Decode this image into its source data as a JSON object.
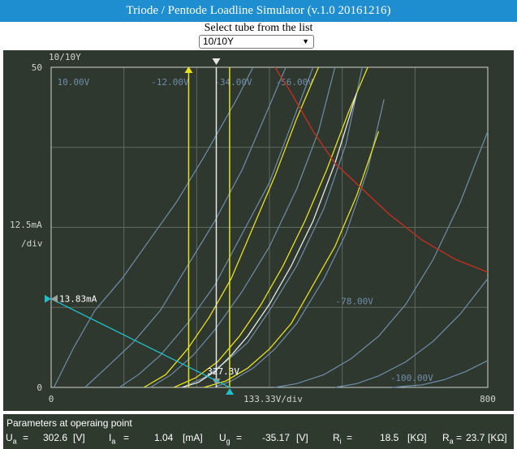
{
  "app": {
    "title": "Triode / Pentode Loadline Simulator (v.1.0 20161216)"
  },
  "selector": {
    "label": "Select tube from the list",
    "selected": "10/10Y"
  },
  "colors": {
    "background": "#2f382f",
    "grid": "#5d6a5d",
    "axis": "#cfd4cf",
    "curve": "#6f8da8",
    "highlight": "#e8e020",
    "operating": "#e8e8e8",
    "dissipation": "#b83020",
    "loadline": "#20c0c8"
  },
  "chart_data": {
    "type": "line",
    "title": "10/10Y",
    "xlim": [
      0,
      800
    ],
    "ylim": [
      0,
      50
    ],
    "x_tick_labels": [
      "0",
      "800"
    ],
    "y_tick_labels": [
      "0",
      "50"
    ],
    "x_div_label": "133.33V/div",
    "y_div_label": [
      "12.5mA",
      "/div"
    ],
    "grid": true,
    "series": [
      {
        "name": "10.00V",
        "anchor_x": 5,
        "x": [
          5,
          40,
          80,
          130,
          180,
          230,
          280,
          340,
          370
        ],
        "y": [
          0,
          6,
          12,
          17,
          23,
          29,
          36,
          45,
          50
        ]
      },
      {
        "name": "",
        "anchor_x": 62,
        "x": [
          62,
          100,
          150,
          200,
          250,
          300,
          350,
          400,
          430
        ],
        "y": [
          0,
          3,
          7,
          12,
          19,
          26,
          34,
          44,
          50
        ]
      },
      {
        "name": "",
        "anchor_x": 125,
        "x": [
          125,
          160,
          200,
          250,
          300,
          350,
          400,
          440,
          480
        ],
        "y": [
          0,
          2,
          5,
          10,
          16,
          24,
          32,
          41,
          50
        ]
      },
      {
        "name": "-12.00V",
        "anchor_x": 182,
        "x": [
          182,
          220,
          260,
          300,
          350,
          400,
          450,
          490,
          520
        ],
        "y": [
          0,
          2,
          5,
          9,
          15,
          22,
          31,
          40,
          50
        ]
      },
      {
        "name": "",
        "anchor_x": 240,
        "x": [
          240,
          280,
          320,
          360,
          400,
          450,
          500,
          540,
          570
        ],
        "y": [
          0,
          1.5,
          4,
          7,
          12,
          19,
          28,
          38,
          50
        ]
      },
      {
        "name": "-34.00V",
        "anchor_x": 298,
        "x": [
          298,
          330,
          370,
          410,
          450,
          500,
          540,
          580,
          610
        ],
        "y": [
          0,
          1,
          3,
          6,
          10,
          17,
          24,
          34,
          45
        ]
      },
      {
        "name": "-56.00V",
        "anchor_x": 410,
        "x": [
          410,
          450,
          500,
          550,
          600,
          650,
          700,
          750,
          800
        ],
        "y": [
          0,
          0.6,
          2,
          4.5,
          8,
          13,
          20,
          29,
          40
        ]
      },
      {
        "name": "-78.00V",
        "anchor_x": 520,
        "x": [
          520,
          560,
          600,
          650,
          700,
          750,
          800
        ],
        "y": [
          0,
          0.6,
          1.8,
          4,
          7.2,
          11.5,
          17
        ]
      },
      {
        "name": "-100.00V",
        "anchor_x": 625,
        "x": [
          625,
          680,
          720,
          760,
          800
        ],
        "y": [
          0,
          0.4,
          1.2,
          2.5,
          4.2
        ]
      }
    ],
    "highlight_series": [
      {
        "x": [
          170,
          210,
          250,
          290,
          330,
          370,
          410,
          450,
          490
        ],
        "y": [
          0,
          2,
          6,
          11,
          17,
          25,
          33,
          42,
          50
        ]
      },
      {
        "x": [
          225,
          265,
          305,
          345,
          385,
          425,
          465,
          505,
          545,
          580
        ],
        "y": [
          0,
          1.5,
          4,
          8,
          13,
          19,
          26,
          34,
          43,
          50
        ]
      },
      {
        "x": [
          280,
          320,
          360,
          400,
          440,
          480,
          520,
          560,
          600
        ],
        "y": [
          0,
          1,
          3,
          6,
          10,
          16,
          22,
          30,
          40
        ]
      }
    ],
    "operating_curve": {
      "x": [
        240,
        270,
        300,
        330,
        360,
        400,
        440,
        480,
        520,
        560
      ],
      "y": [
        0,
        0.8,
        2.5,
        5,
        8,
        13,
        19,
        26,
        35,
        46
      ]
    },
    "dissipation_curve": {
      "x": [
        410,
        440,
        480,
        520,
        570,
        620,
        680,
        740,
        800
      ],
      "y": [
        50,
        46,
        40,
        35,
        31,
        27,
        23,
        20,
        18
      ]
    },
    "load_line": {
      "x": [
        0,
        327.3
      ],
      "y": [
        13.83,
        0
      ]
    },
    "vertical_markers": [
      {
        "x": 252,
        "kind": "highlight",
        "direction": "up"
      },
      {
        "x": 302.6,
        "kind": "operating",
        "direction": "down"
      },
      {
        "x": 327,
        "kind": "highlight",
        "direction": "none"
      }
    ],
    "annotations": {
      "y_marker": {
        "label": "13.83mA",
        "value": 13.83
      },
      "x_marker": {
        "label": "327.3V",
        "value": 327.3
      }
    }
  },
  "params": {
    "title": "Parameters at operaing point",
    "ua": {
      "label": "U",
      "sub": "a",
      "eq": "=",
      "value": "302.6",
      "unit": "[V]"
    },
    "ia": {
      "label": "I",
      "sub": "a",
      "eq": "=",
      "value": "1.04",
      "unit": "[mA]"
    },
    "ug": {
      "label": "U",
      "sub": "g",
      "eq": "=",
      "value": "-35.17",
      "unit": "[V]"
    },
    "ri": {
      "label": "R",
      "sub": "i",
      "eq": "=",
      "value": "18.5",
      "unit": "[KΩ]"
    },
    "ra": {
      "label": "R",
      "sub": "a",
      "eq": "=",
      "value": "23.7",
      "unit": "[KΩ]"
    }
  }
}
